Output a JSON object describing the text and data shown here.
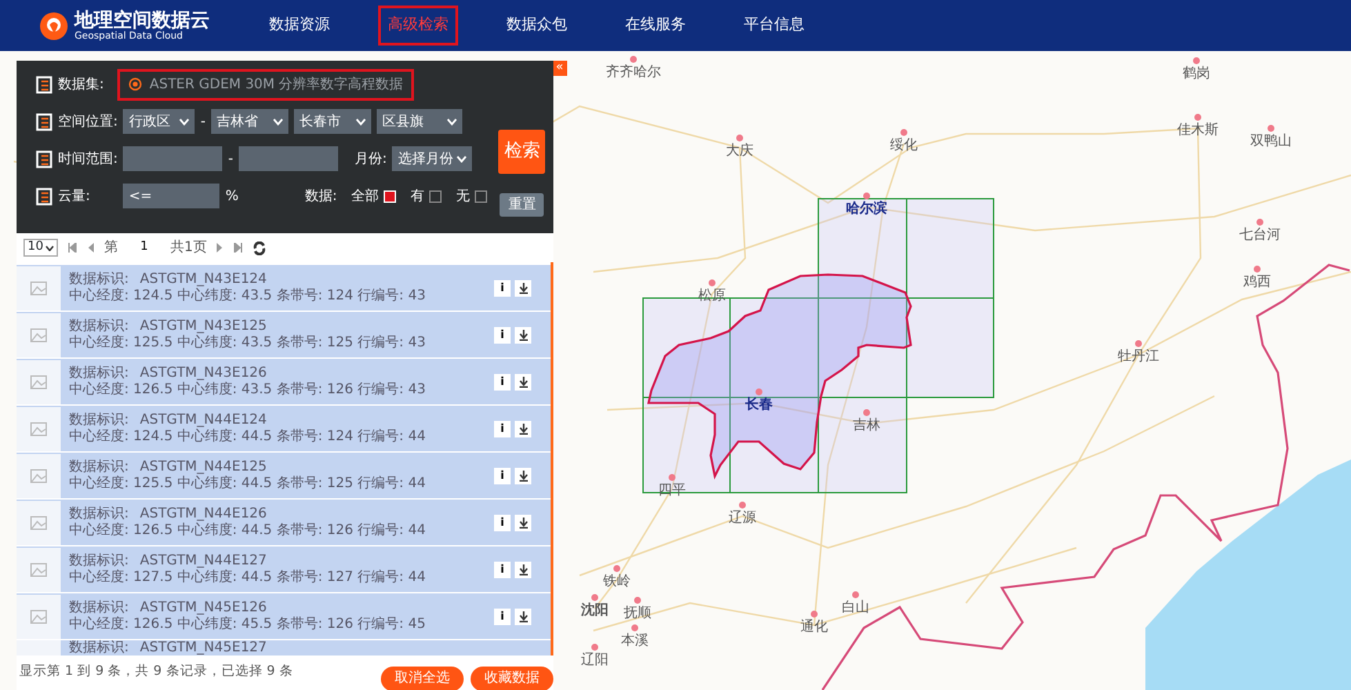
{
  "header": {
    "logo_title": "地理空间数据云",
    "logo_subtitle": "Geospatial Data Cloud",
    "nav": [
      {
        "label": "数据资源",
        "selected": false
      },
      {
        "label": "高级检索",
        "selected": true
      },
      {
        "label": "数据众包",
        "selected": false
      },
      {
        "label": "在线服务",
        "selected": false
      },
      {
        "label": "平台信息",
        "selected": false
      }
    ]
  },
  "search": {
    "dataset_label": "数据集:",
    "dataset": "ASTER GDEM 30M 分辨率数字高程数据",
    "location_label": "空间位置:",
    "location_selects": [
      "行政区",
      "吉林省",
      "长春市",
      "区县旗"
    ],
    "separator": "-",
    "time_label": "时间范围:",
    "time_separator": "-",
    "month_label": "月份:",
    "month_select": "选择月份",
    "cloud_label": "云量:",
    "cloud_value": "<=",
    "cloud_unit": "%",
    "data_label": "数据:",
    "data_options": [
      {
        "label": "全部",
        "checked": true
      },
      {
        "label": "有",
        "checked": false
      },
      {
        "label": "无",
        "checked": false
      }
    ],
    "search_button": "检索",
    "reset_button": "重置"
  },
  "pager": {
    "page_size": "10",
    "page_prefix": "第",
    "page": "1",
    "page_total": "共1页"
  },
  "results": [
    {
      "id_label": "数据标识:",
      "id": "ASTGTM_N43E124",
      "detail": "中心经度: 124.5 中心纬度: 43.5 条带号: 124 行编号: 43",
      "info": "i",
      "selected": true
    },
    {
      "id_label": "数据标识:",
      "id": "ASTGTM_N43E125",
      "detail": "中心经度: 125.5 中心纬度: 43.5 条带号: 125 行编号: 43",
      "info": "i",
      "selected": true
    },
    {
      "id_label": "数据标识:",
      "id": "ASTGTM_N43E126",
      "detail": "中心经度: 126.5 中心纬度: 43.5 条带号: 126 行编号: 43",
      "info": "i",
      "selected": true
    },
    {
      "id_label": "数据标识:",
      "id": "ASTGTM_N44E124",
      "detail": "中心经度: 124.5 中心纬度: 44.5 条带号: 124 行编号: 44",
      "info": "i",
      "selected": true
    },
    {
      "id_label": "数据标识:",
      "id": "ASTGTM_N44E125",
      "detail": "中心经度: 125.5 中心纬度: 44.5 条带号: 125 行编号: 44",
      "info": "i",
      "selected": true
    },
    {
      "id_label": "数据标识:",
      "id": "ASTGTM_N44E126",
      "detail": "中心经度: 126.5 中心纬度: 44.5 条带号: 126 行编号: 44",
      "info": "i",
      "selected": true
    },
    {
      "id_label": "数据标识:",
      "id": "ASTGTM_N44E127",
      "detail": "中心经度: 127.5 中心纬度: 44.5 条带号: 127 行编号: 44",
      "info": "i",
      "selected": true
    },
    {
      "id_label": "数据标识:",
      "id": "ASTGTM_N45E126",
      "detail": "中心经度: 126.5 中心纬度: 45.5 条带号: 126 行编号: 45",
      "info": "i",
      "selected": true
    },
    {
      "id_label": "数据标识:",
      "id": "ASTGTM_N45E127",
      "selected": true
    }
  ],
  "footer": {
    "summary": "显示第 1 到 9 条，共 9 条记录，已选择 9 条",
    "buttons": [
      "取消全选",
      "收藏数据"
    ]
  },
  "map": {
    "collapse": "«",
    "cities": [
      {
        "name": "齐齐哈尔"
      },
      {
        "name": "鹤岗"
      },
      {
        "name": "大庆"
      },
      {
        "name": "绥化"
      },
      {
        "name": "佳木斯"
      },
      {
        "name": "双鸭山"
      },
      {
        "name": "哈尔滨"
      },
      {
        "name": "七台河"
      },
      {
        "name": "松原"
      },
      {
        "name": "鸡西"
      },
      {
        "name": "牡丹江"
      },
      {
        "name": "长春"
      },
      {
        "name": "吉林"
      },
      {
        "name": "四平"
      },
      {
        "name": "辽源"
      },
      {
        "name": "铁岭"
      },
      {
        "name": "沈阳"
      },
      {
        "name": "抚顺"
      },
      {
        "name": "本溪"
      },
      {
        "name": "辽阳"
      },
      {
        "name": "通化"
      },
      {
        "name": "白山"
      }
    ]
  }
}
